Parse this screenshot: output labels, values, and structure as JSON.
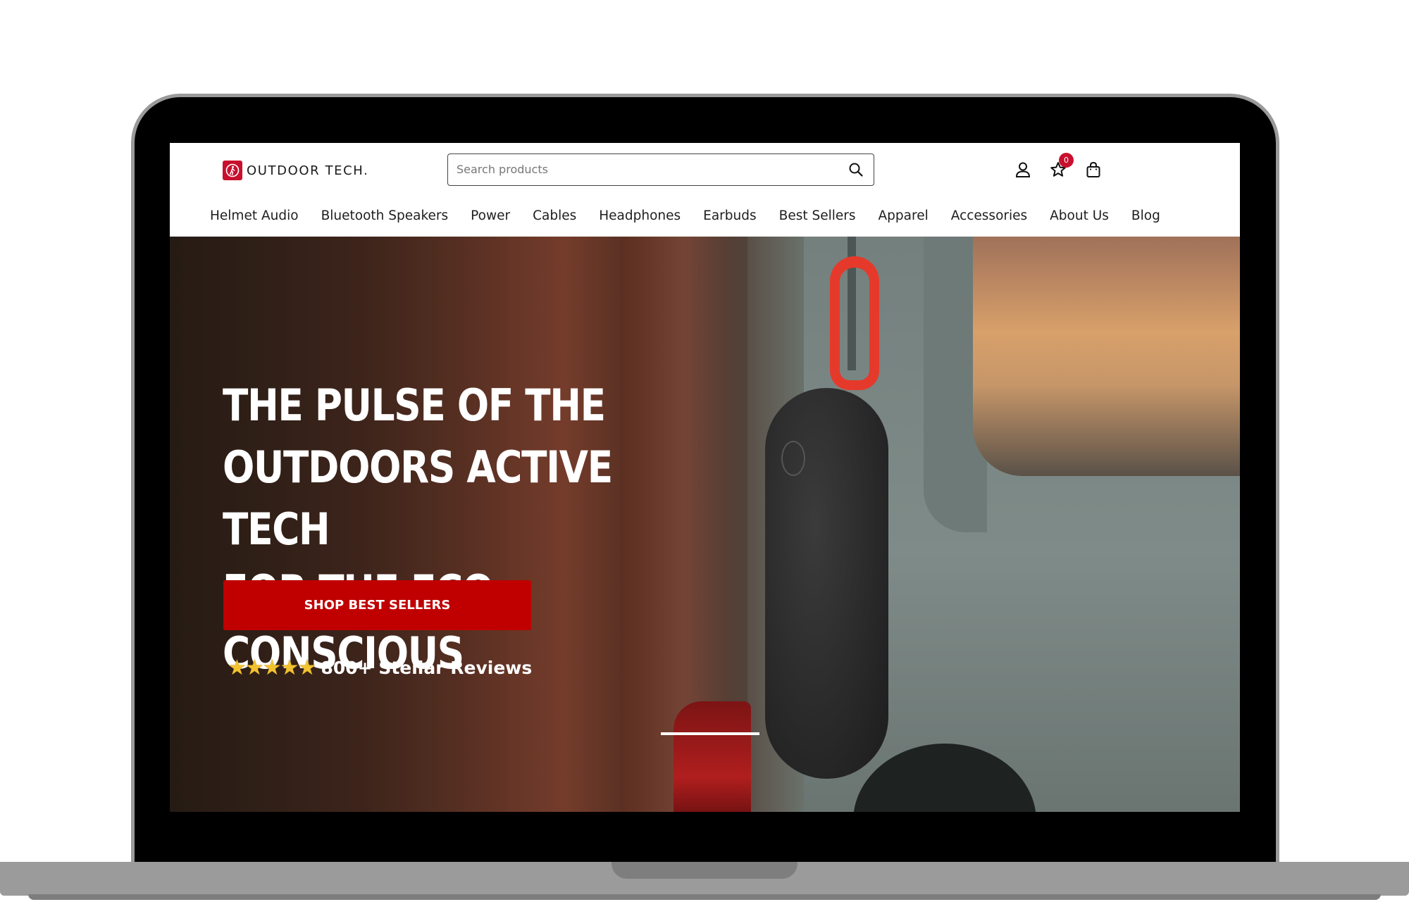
{
  "brand": {
    "name": "OUTDOOR TECH.",
    "accent_color": "#c8102e"
  },
  "search": {
    "placeholder": "Search products",
    "icon": "search-icon"
  },
  "header_icons": {
    "account": "user-icon",
    "favorites": "star-icon",
    "favorites_count": "0",
    "cart": "shopping-bag-icon"
  },
  "nav": {
    "items": [
      {
        "label": "Helmet Audio"
      },
      {
        "label": "Bluetooth Speakers"
      },
      {
        "label": "Power"
      },
      {
        "label": "Cables"
      },
      {
        "label": "Headphones"
      },
      {
        "label": "Earbuds"
      },
      {
        "label": "Best Sellers"
      },
      {
        "label": "Apparel"
      },
      {
        "label": "Accessories"
      },
      {
        "label": "About Us"
      },
      {
        "label": "Blog"
      }
    ]
  },
  "hero": {
    "headline": [
      "THE PULSE OF THE",
      "OUTDOORS ACTIVE TECH",
      "FOR THE ECO-CONSCIOUS"
    ],
    "cta_label": "SHOP BEST SELLERS",
    "cta_color": "#c00000",
    "rating_stars": "★★★★★",
    "reviews_text": "800+ Stellar Reviews"
  }
}
